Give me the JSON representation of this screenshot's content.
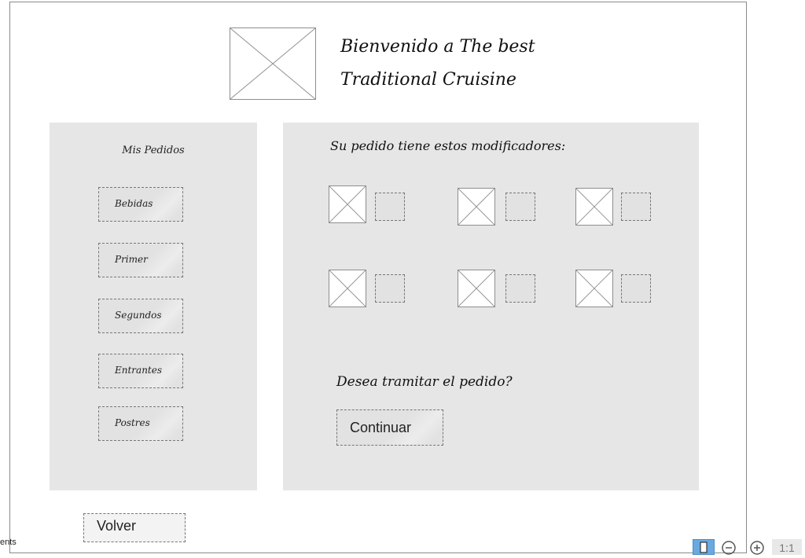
{
  "header": {
    "title_line1": "Bienvenido a The best",
    "title_line2": "Traditional Cruisine",
    "image_placeholder_icon": "image-placeholder-icon"
  },
  "sidebar": {
    "title": "Mis Pedidos",
    "items": [
      {
        "label": "Bebidas"
      },
      {
        "label": "Primer"
      },
      {
        "label": "Segundos"
      },
      {
        "label": "Entrantes"
      },
      {
        "label": "Postres"
      }
    ]
  },
  "main": {
    "modifiers_title": "Su pedido tiene estos modificadores:",
    "confirm_question": "Desea tramitar el pedido?",
    "continue_label": "Continuar"
  },
  "footer": {
    "back_label": "Volver",
    "elements_label": "ents"
  },
  "toolbar": {
    "reset_zoom_label": "1:1",
    "icons": [
      "page-icon",
      "zoom-out-icon",
      "zoom-in-icon"
    ]
  },
  "colors": {
    "panel": "#e6e6e6",
    "border": "#8a8a8a",
    "toolbar_active": "#6aa9e0"
  }
}
